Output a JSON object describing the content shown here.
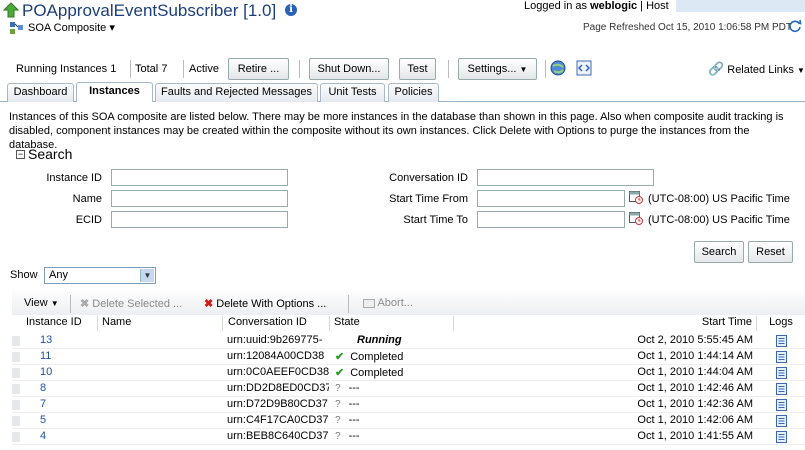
{
  "header": {
    "title": "POApprovalEventSubscriber [1.0]",
    "composite_menu": "SOA Composite ▾",
    "logged_in_prefix": "Logged in as ",
    "user": "weblogic",
    "host_label": "Host",
    "page_refreshed": "Page Refreshed Oct 15, 2010 1:06:58 PM PDT"
  },
  "toolbar": {
    "running_label": "Running Instances",
    "running_count": "1",
    "total_label": "Total",
    "total_count": "7",
    "status": "Active",
    "retire": "Retire ...",
    "shutdown": "Shut Down...",
    "test": "Test",
    "settings": "Settings...",
    "related_links": "Related Links"
  },
  "tabs": [
    {
      "label": "Dashboard"
    },
    {
      "label": "Instances"
    },
    {
      "label": "Faults and Rejected Messages"
    },
    {
      "label": "Unit Tests"
    },
    {
      "label": "Policies"
    }
  ],
  "description": "Instances of this SOA composite are listed below. There may be more instances in the database than shown in this page. Also when composite audit tracking is disabled, component instances may be created within the composite without its own instances. Click Delete with Options to purge the instances from the database.",
  "search": {
    "heading": "Search",
    "instance_id": "Instance ID",
    "name": "Name",
    "ecid": "ECID",
    "conversation_id": "Conversation ID",
    "start_from": "Start Time From",
    "start_to": "Start Time To",
    "timezone": "(UTC-08:00) US Pacific Time",
    "search_btn": "Search",
    "reset_btn": "Reset"
  },
  "show": {
    "label": "Show",
    "value": "Any"
  },
  "grid_toolbar": {
    "view": "View",
    "delete_selected": "Delete Selected ...",
    "delete_with_options": "Delete With Options ...",
    "abort": "Abort..."
  },
  "grid": {
    "headers": {
      "instance_id": "Instance ID",
      "name": "Name",
      "conversation_id": "Conversation ID",
      "state": "State",
      "start_time": "Start Time",
      "logs": "Logs"
    },
    "rows": [
      {
        "id": "13",
        "name": "",
        "conv": "urn:uuid:9b269775-",
        "state": "Running",
        "state_kind": "running",
        "start": "Oct 2, 2010 5:55:45 AM"
      },
      {
        "id": "11",
        "name": "",
        "conv": "urn:12084A00CD38",
        "state": "Completed",
        "state_kind": "completed",
        "start": "Oct 1, 2010 1:44:14 AM"
      },
      {
        "id": "10",
        "name": "",
        "conv": "urn:0C0AEEF0CD38",
        "state": "Completed",
        "state_kind": "completed",
        "start": "Oct 1, 2010 1:44:04 AM"
      },
      {
        "id": "8",
        "name": "",
        "conv": "urn:DD2D8ED0CD37",
        "state": "---",
        "state_kind": "unknown",
        "start": "Oct 1, 2010 1:42:46 AM"
      },
      {
        "id": "7",
        "name": "",
        "conv": "urn:D72D9B80CD37",
        "state": "---",
        "state_kind": "unknown",
        "start": "Oct 1, 2010 1:42:36 AM"
      },
      {
        "id": "5",
        "name": "",
        "conv": "urn:C4F17CA0CD37",
        "state": "---",
        "state_kind": "unknown",
        "start": "Oct 1, 2010 1:42:06 AM"
      },
      {
        "id": "4",
        "name": "",
        "conv": "urn:BEB8C640CD37",
        "state": "---",
        "state_kind": "unknown",
        "start": "Oct 1, 2010 1:41:55 AM"
      }
    ]
  }
}
